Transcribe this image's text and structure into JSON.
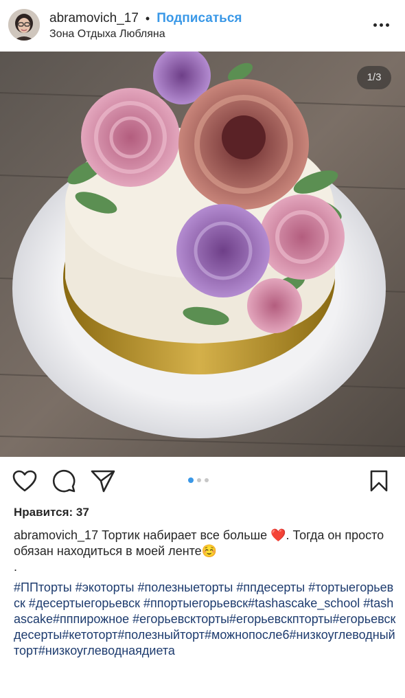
{
  "post": {
    "username": "abramovich_17",
    "separator": "•",
    "follow_label": "Подписаться",
    "location": "Зона Отдыха Любляна",
    "more_icon": "more-horizontal-icon"
  },
  "media": {
    "counter": "1/3",
    "description_icon": "cake-photo",
    "carousel_pages": 3,
    "active_page": 1
  },
  "actions": {
    "like_icon": "heart-icon",
    "comment_icon": "comment-icon",
    "share_icon": "paper-plane-icon",
    "save_icon": "bookmark-icon"
  },
  "likes": "Нравится: 37",
  "caption": {
    "username": "abramovich_17",
    "text": " Тортик набирает все больше ❤️. Тогда он просто обязан находиться в моей ленте☺️",
    "separator": ".",
    "hashtags": "#ППторты #экоторты #полезныеторты #ппдесерты #тортыегорьевск #десертыегорьевск #ппортыегорьевск#tashascake_school #tashascake#пппирожное #егорьевскторты#егорьевскпторты#егорьевскдесерты#кетоторт#полезныйторт#можнопосле6#низкоуглеводныйторт#низкоуглеводнаядиета"
  },
  "colors": {
    "follow": "#3a98e7",
    "hashtag": "#1d3b6e",
    "carousel_active": "#3a98e7",
    "carousel_inactive": "#c7c7c7"
  }
}
